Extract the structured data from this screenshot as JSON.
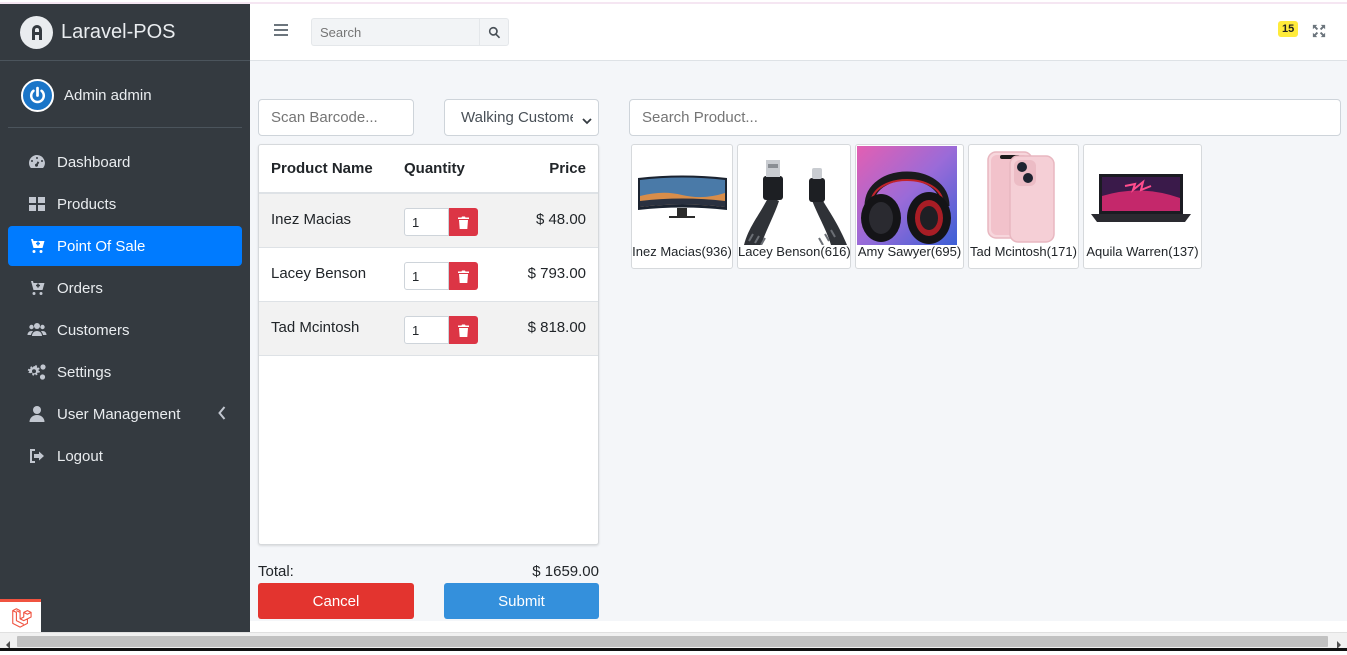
{
  "brand": {
    "title": "Laravel-POS"
  },
  "user": {
    "name": "Admin admin"
  },
  "sidebar": {
    "items": [
      {
        "label": "Dashboard",
        "icon": "dashboard-icon"
      },
      {
        "label": "Products",
        "icon": "grid-icon"
      },
      {
        "label": "Point Of Sale",
        "icon": "cart-plus-icon",
        "active": true
      },
      {
        "label": "Orders",
        "icon": "cart-icon"
      },
      {
        "label": "Customers",
        "icon": "users-icon"
      },
      {
        "label": "Settings",
        "icon": "gears-icon"
      },
      {
        "label": "User Management",
        "icon": "user-icon",
        "has_submenu": true
      },
      {
        "label": "Logout",
        "icon": "logout-icon"
      }
    ]
  },
  "header": {
    "search_placeholder": "Search",
    "notification_count": "15"
  },
  "pos": {
    "barcode_placeholder": "Scan Barcode...",
    "customer_selected": "Walking Customer",
    "product_search_placeholder": "Search Product...",
    "table": {
      "headers": {
        "name": "Product Name",
        "quantity": "Quantity",
        "price": "Price"
      },
      "rows": [
        {
          "name": "Inez Macias",
          "quantity": "1",
          "price": "$ 48.00"
        },
        {
          "name": "Lacey Benson",
          "quantity": "1",
          "price": "$ 793.00"
        },
        {
          "name": "Tad Mcintosh",
          "quantity": "1",
          "price": "$ 818.00"
        }
      ]
    },
    "total_label": "Total:",
    "total_value": "$ 1659.00",
    "cancel_label": "Cancel",
    "submit_label": "Submit"
  },
  "products": [
    {
      "label": "Inez Macias(936)",
      "image": "monitor"
    },
    {
      "label": "Lacey Benson(616)",
      "image": "usb-cable"
    },
    {
      "label": "Amy Sawyer(695)",
      "image": "headphones"
    },
    {
      "label": "Tad Mcintosh(171)",
      "image": "phone"
    },
    {
      "label": "Aquila Warren(137)",
      "image": "laptop"
    }
  ],
  "colors": {
    "sidebar_bg": "#343a40",
    "active_nav": "#007bff",
    "cancel": "#e3342f",
    "submit": "#3490dc",
    "delete": "#dc3545",
    "badge": "#ffeb3b"
  }
}
